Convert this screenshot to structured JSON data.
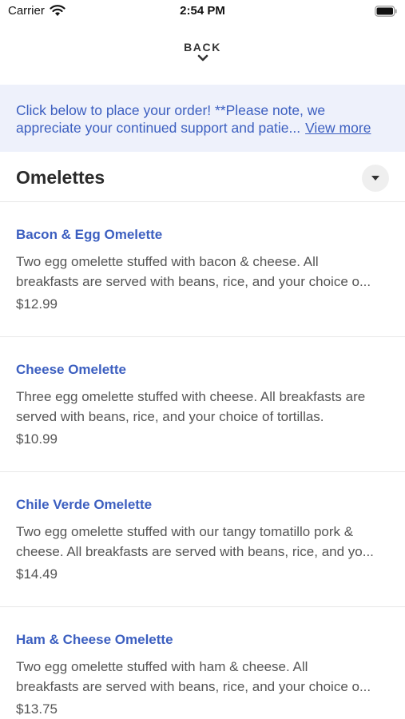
{
  "status_bar": {
    "carrier": "Carrier",
    "time": "2:54 PM"
  },
  "nav": {
    "back_label": "BACK"
  },
  "notice": {
    "line1": "Click below to place your order! **Please note, we",
    "line2": "appreciate your continued support and patie...",
    "view_more": "View more"
  },
  "section": {
    "title": "Omelettes"
  },
  "items": [
    {
      "name": "Bacon & Egg Omelette",
      "desc_line1": "Two egg omelette stuffed with bacon & cheese. All",
      "desc_line2": "breakfasts are served with beans, rice, and your choice o...",
      "price": "$12.99"
    },
    {
      "name": "Cheese Omelette",
      "desc_line1": "Three egg omelette stuffed with cheese. All breakfasts are",
      "desc_line2": "served with beans, rice, and your choice of tortillas.",
      "price": "$10.99"
    },
    {
      "name": "Chile Verde Omelette",
      "desc_line1": "Two egg omelette stuffed with our tangy tomatillo pork &",
      "desc_line2": "cheese. All breakfasts are served with beans, rice, and yo...",
      "price": "$14.49"
    },
    {
      "name": "Ham & Cheese Omelette",
      "desc_line1": "Two egg omelette stuffed with ham & cheese. All",
      "desc_line2": "breakfasts are served with beans, rice, and your choice o...",
      "price": "$13.75"
    }
  ],
  "colors": {
    "accent": "#3c5fc0",
    "notice_bg": "#eef1fb"
  },
  "icons": {
    "wifi": "wifi-icon",
    "battery": "battery-icon",
    "back": "chevron-down-icon",
    "toggle": "caret-down-icon"
  }
}
